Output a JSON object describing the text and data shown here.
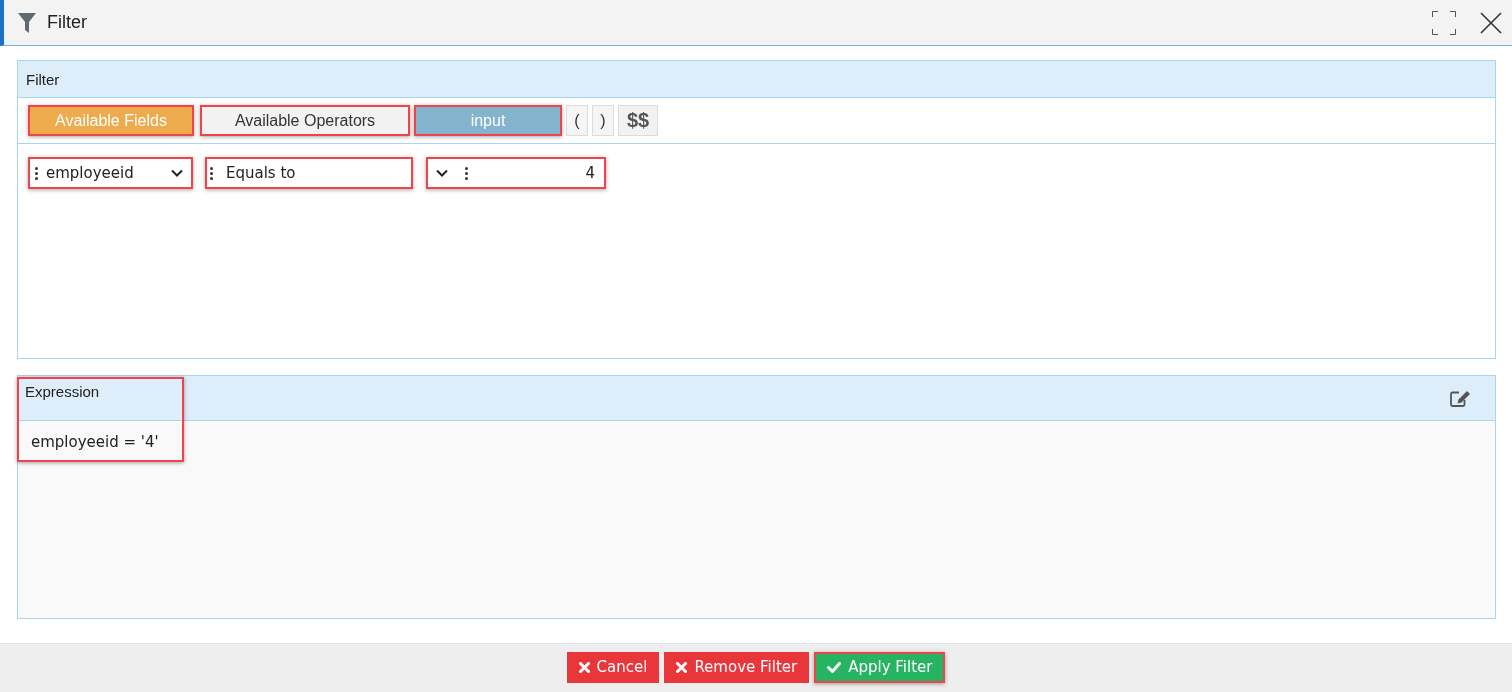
{
  "window": {
    "title": "Filter"
  },
  "filter_panel": {
    "heading": "Filter",
    "toolbar": [
      {
        "label": "Available Fields",
        "kind": "fields",
        "highlighted": true
      },
      {
        "label": "Available Operators",
        "kind": "operators",
        "highlighted": true
      },
      {
        "label": "input",
        "kind": "input",
        "highlighted": true
      },
      {
        "label": "(",
        "kind": "paren",
        "highlighted": false
      },
      {
        "label": ")",
        "kind": "paren",
        "highlighted": false
      },
      {
        "label": "$$",
        "kind": "variable",
        "highlighted": false
      }
    ],
    "condition": [
      {
        "kind": "dropdown",
        "value": "employeeid",
        "highlighted": true
      },
      {
        "kind": "operator",
        "value": "Equals to",
        "highlighted": true
      },
      {
        "kind": "value",
        "value": "4",
        "highlighted": true
      }
    ]
  },
  "expression_panel": {
    "heading": "Expression",
    "text": "employeeid = '4'",
    "highlighted": true
  },
  "footer": {
    "buttons": [
      {
        "label": "Cancel",
        "kind": "cancel",
        "highlighted": false
      },
      {
        "label": "Remove Filter",
        "kind": "remove",
        "highlighted": false
      },
      {
        "label": "Apply Filter",
        "kind": "apply",
        "highlighted": true
      }
    ]
  }
}
